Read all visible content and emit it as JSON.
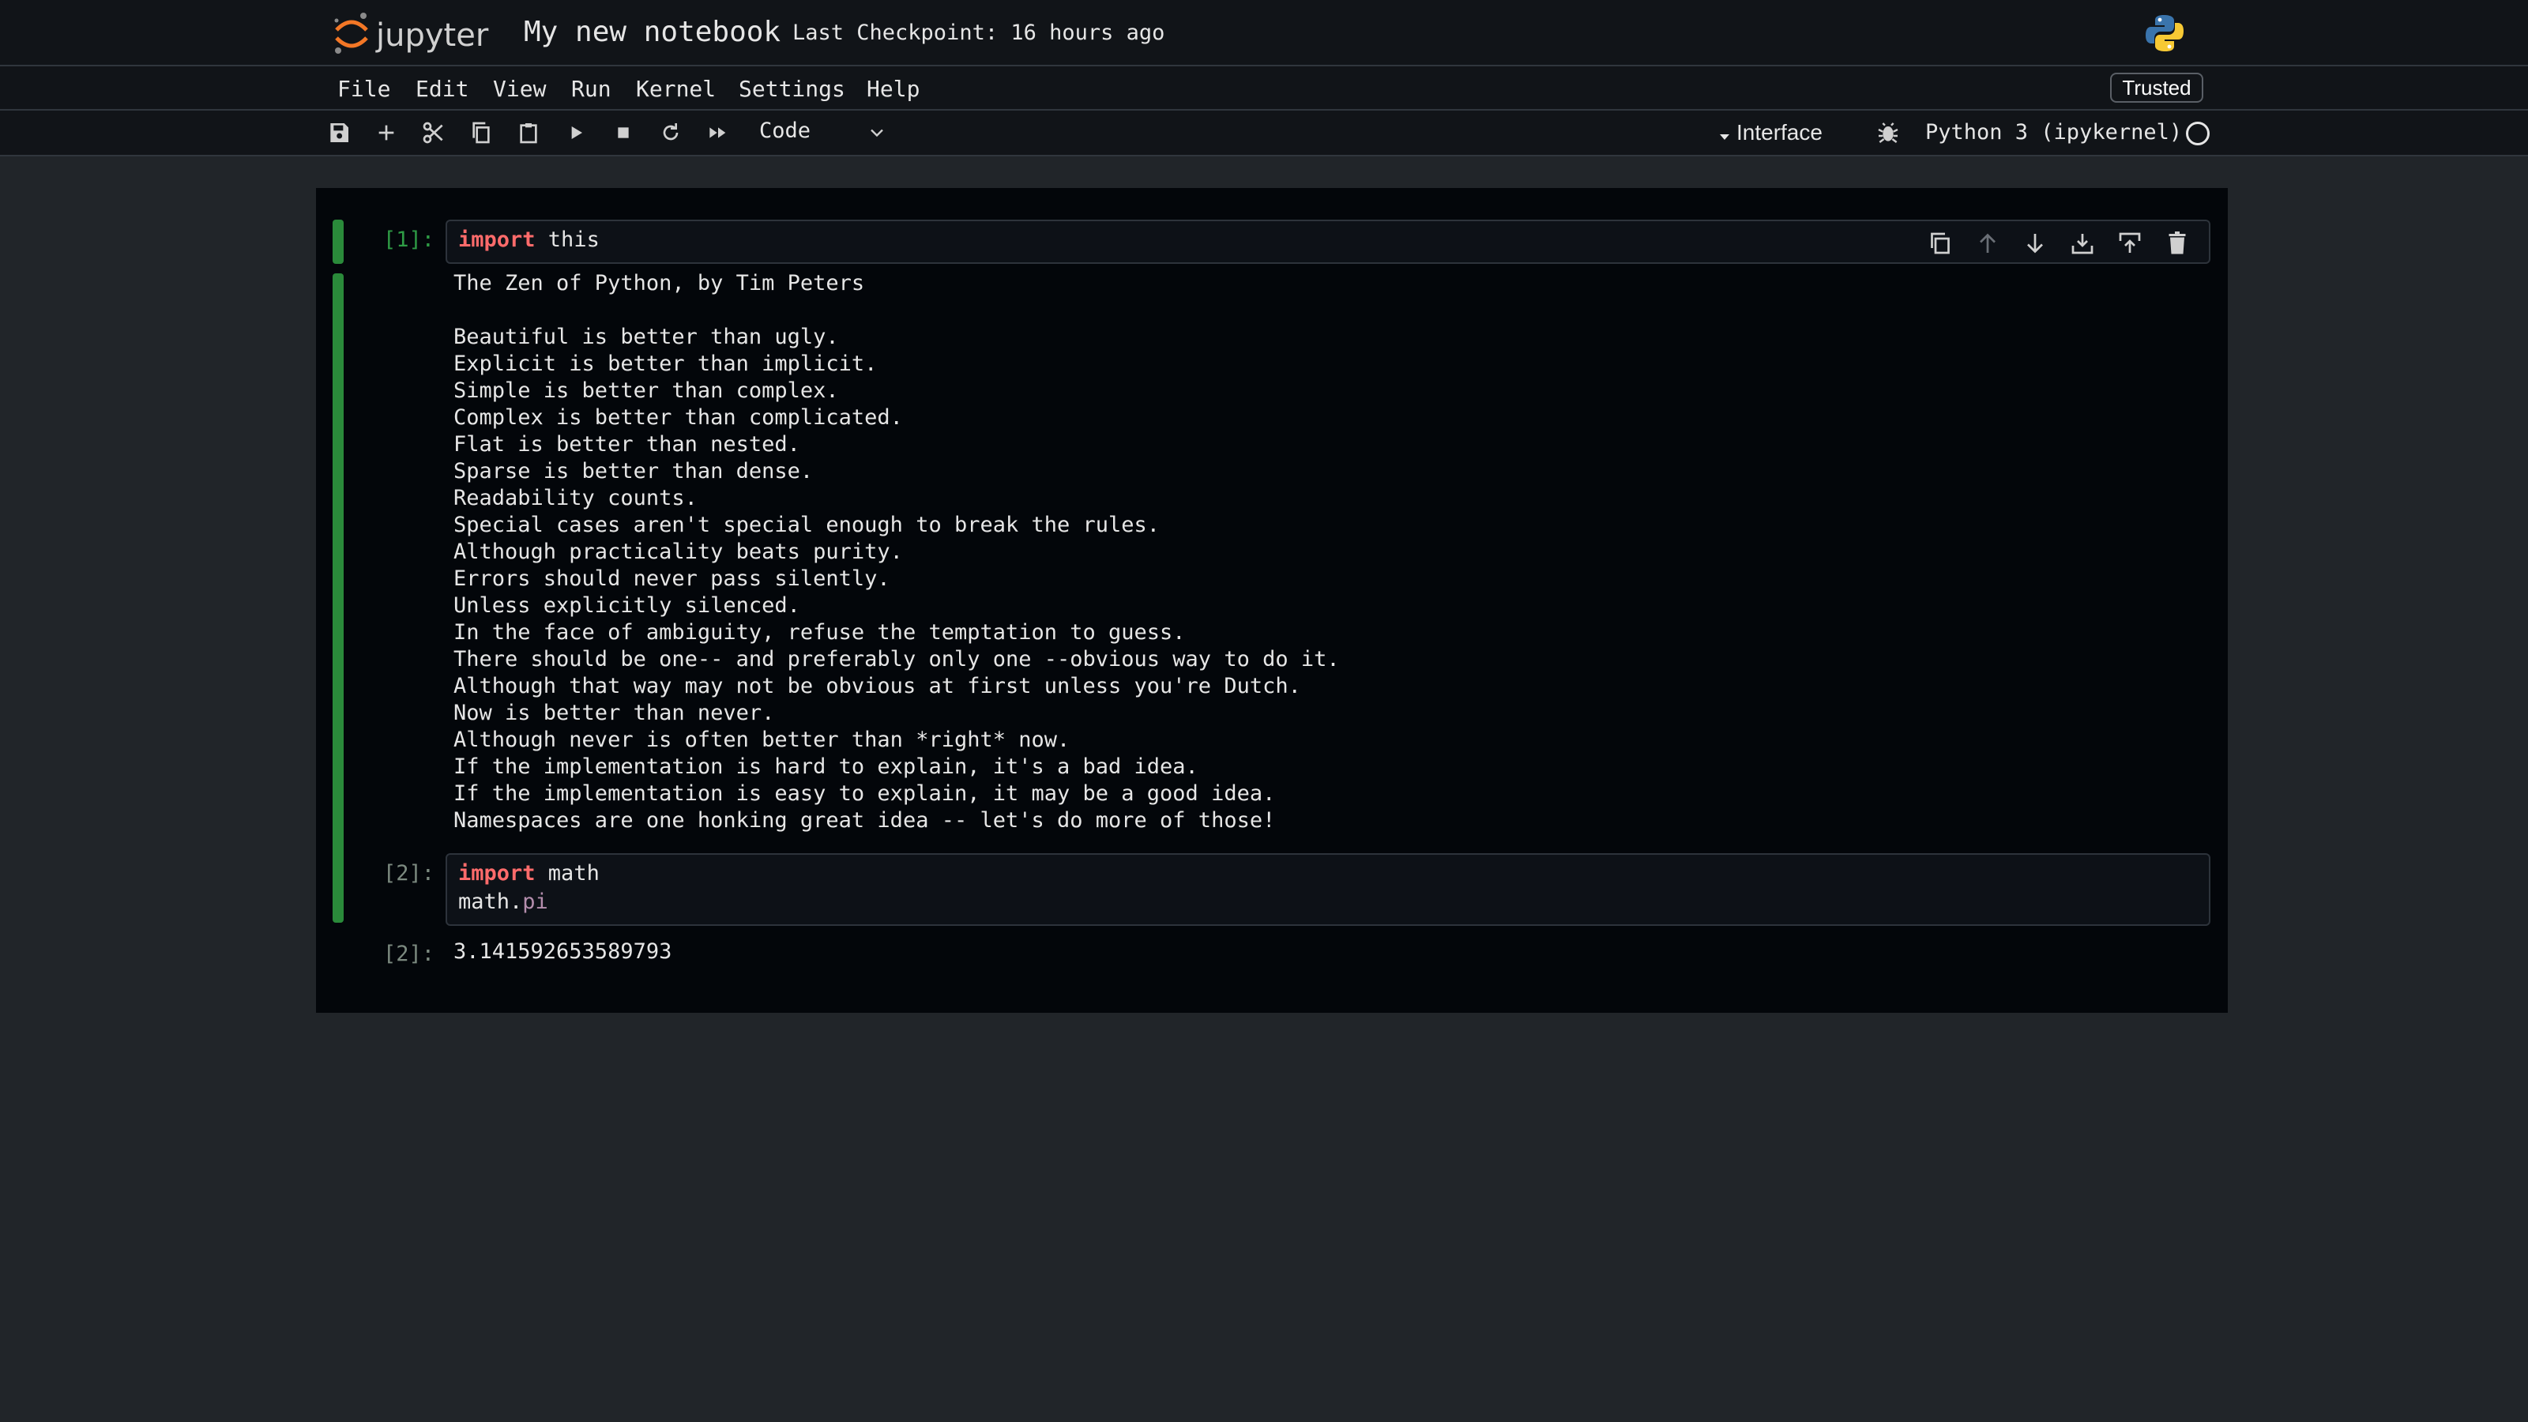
{
  "app": {
    "logo_text": "jupyter",
    "notebook_title": "My new notebook",
    "checkpoint": "Last Checkpoint: 16 hours ago"
  },
  "menu": {
    "items": [
      "File",
      "Edit",
      "View",
      "Run",
      "Kernel",
      "Settings",
      "Help"
    ],
    "trusted_label": "Trusted"
  },
  "toolbar": {
    "icons": [
      "save-icon",
      "add-cell-icon",
      "cut-icon",
      "copy-icon",
      "paste-icon",
      "run-icon",
      "stop-icon",
      "restart-icon",
      "run-all-icon"
    ],
    "cell_type": "Code",
    "interface_label": "Interface",
    "kernel_name": "Python 3 (ipykernel)"
  },
  "colors": {
    "accent_green": "#2a8a3a",
    "keyword": "#ff6b6b",
    "attribute": "#b48ead"
  },
  "cells": [
    {
      "prompt": "[1]:",
      "code": [
        {
          "kw": "import",
          "rest": " this"
        }
      ],
      "output": "The Zen of Python, by Tim Peters\n\nBeautiful is better than ugly.\nExplicit is better than implicit.\nSimple is better than complex.\nComplex is better than complicated.\nFlat is better than nested.\nSparse is better than dense.\nReadability counts.\nSpecial cases aren't special enough to break the rules.\nAlthough practicality beats purity.\nErrors should never pass silently.\nUnless explicitly silenced.\nIn the face of ambiguity, refuse the temptation to guess.\nThere should be one-- and preferably only one --obvious way to do it.\nAlthough that way may not be obvious at first unless you're Dutch.\nNow is better than never.\nAlthough never is often better than *right* now.\nIf the implementation is hard to explain, it's a bad idea.\nIf the implementation is easy to explain, it may be a good idea.\nNamespaces are one honking great idea -- let's do more of those!"
    },
    {
      "prompt": "[2]:",
      "code_line1_kw": "import",
      "code_line1_rest": " math",
      "code_line2_obj": "math.",
      "code_line2_attr": "pi",
      "output_prompt": "[2]:",
      "output": "3.141592653589793"
    }
  ],
  "cell_toolbar": [
    "duplicate-icon",
    "move-up-icon",
    "move-down-icon",
    "insert-below-icon",
    "insert-above-icon",
    "delete-icon"
  ]
}
